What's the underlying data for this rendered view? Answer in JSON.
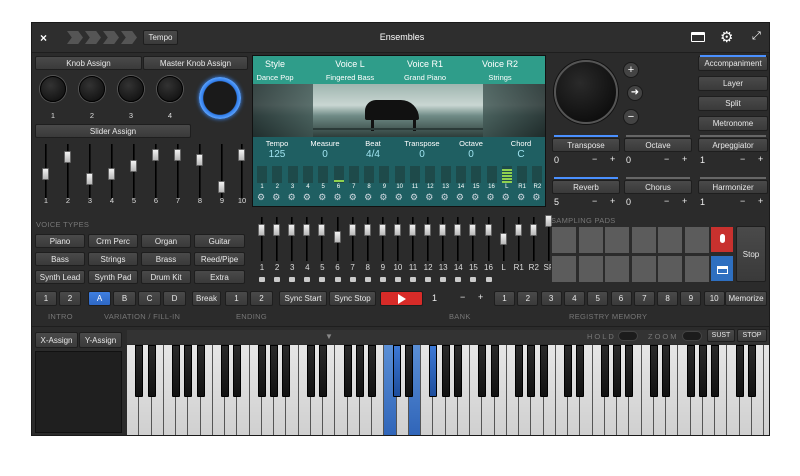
{
  "title": "Ensembles",
  "tempo_button": "Tempo",
  "icons": {
    "close": "close-icon",
    "folder": "folder-icon",
    "settings": "gear-icon",
    "fullscreen": "fullscreen-icon"
  },
  "knob_assign": "Knob Assign",
  "master_knob_assign": "Master Knob Assign",
  "knob_numbers": [
    "1",
    "2",
    "3",
    "4"
  ],
  "slider_assign": "Slider Assign",
  "slider_numbers": [
    "1",
    "2",
    "3",
    "4",
    "5",
    "6",
    "7",
    "8",
    "9",
    "10"
  ],
  "slider_levels": [
    0.45,
    0.75,
    0.35,
    0.45,
    0.6,
    0.8,
    0.8,
    0.7,
    0.2,
    0.8
  ],
  "screen": {
    "headers": [
      "Style",
      "Voice L",
      "Voice R1",
      "Voice R2"
    ],
    "values": [
      "Dance Pop",
      "Fingered Bass",
      "Grand Piano",
      "Strings"
    ],
    "stats_labels": [
      "Tempo",
      "Measure",
      "Beat",
      "Transpose",
      "Octave",
      "Chord"
    ],
    "stats_values": [
      "125",
      "0",
      "4/4",
      "0",
      "0",
      "C"
    ],
    "channels": [
      "1",
      "2",
      "3",
      "4",
      "5",
      "6",
      "7",
      "8",
      "9",
      "10",
      "11",
      "12",
      "13",
      "14",
      "15",
      "16",
      "L",
      "R1",
      "R2"
    ]
  },
  "right_buttons": [
    "Accompaniment",
    "Layer",
    "Split",
    "Metronome"
  ],
  "effects": [
    {
      "name": "Transpose",
      "value": "0",
      "active": true
    },
    {
      "name": "Octave",
      "value": "0",
      "active": false
    },
    {
      "name": "Arpeggiator",
      "value": "1",
      "active": false
    },
    {
      "name": "Reverb",
      "value": "5",
      "active": true
    },
    {
      "name": "Chorus",
      "value": "0",
      "active": false
    },
    {
      "name": "Harmonizer",
      "value": "1",
      "active": false
    }
  ],
  "spin_minus": "−",
  "spin_plus": "+",
  "voice_types_label": "VOICE TYPES",
  "voice_types": [
    "Piano",
    "Crm Perc",
    "Organ",
    "Guitar",
    "Bass",
    "Strings",
    "Brass",
    "Reed/Pipe",
    "Synth Lead",
    "Synth Pad",
    "Drum Kit",
    "Extra"
  ],
  "mixer_labels": [
    "1",
    "2",
    "3",
    "4",
    "5",
    "6",
    "7",
    "8",
    "9",
    "10",
    "11",
    "12",
    "13",
    "14",
    "15",
    "16",
    "L",
    "R1",
    "R2",
    "SP"
  ],
  "mixer_levels": [
    0.7,
    0.7,
    0.7,
    0.7,
    0.7,
    0.55,
    0.7,
    0.7,
    0.7,
    0.7,
    0.7,
    0.7,
    0.7,
    0.7,
    0.7,
    0.7,
    0.5,
    0.7,
    0.7,
    0.9
  ],
  "sampling_pads_label": "SAMPLING PADS",
  "stop_label": "Stop",
  "intro_buttons": [
    "1",
    "2"
  ],
  "variation_buttons": [
    "A",
    "B",
    "C",
    "D"
  ],
  "break_label": "Break",
  "ending_buttons": [
    "1",
    "2"
  ],
  "sync_start": "Sync Start",
  "sync_stop": "Sync Stop",
  "bank_value": "1",
  "registry_buttons": [
    "1",
    "2",
    "3",
    "4",
    "5",
    "6",
    "7",
    "8",
    "9",
    "10"
  ],
  "memorize": "Memorize",
  "section_labels": {
    "intro": "INTRO",
    "variation": "VARIATION / FILL-IN",
    "ending": "ENDING",
    "bank": "BANK",
    "registry": "REGISTRY MEMORY"
  },
  "x_assign": "X-Assign",
  "y_assign": "Y-Assign",
  "hold": "HOLD",
  "zoom": "ZOOM",
  "sust": "SUST",
  "stop_small": "STOP"
}
